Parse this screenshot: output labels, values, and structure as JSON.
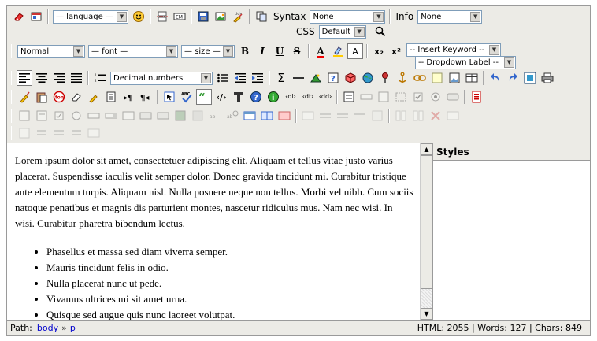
{
  "toolbar": {
    "language_select": "— language —",
    "syntax_label": "Syntax",
    "syntax_value": "None",
    "info_label": "Info",
    "info_value": "None",
    "css_label": "CSS",
    "css_value": "Default",
    "format_select": "Normal",
    "font_select": "— font —",
    "size_select": "— size —",
    "bold": "B",
    "italic": "I",
    "underline": "U",
    "strike": "S",
    "font_color_letter": "A",
    "highlight_letter": "A",
    "subscript": "x₂",
    "superscript": "x²",
    "insert_keyword": "-- Insert Keyword --",
    "dropdown_label": "-- Dropdown Label --",
    "list_style_select": "Decimal numbers",
    "sigma": "Σ",
    "dl_tags": [
      "‹dl›",
      "‹dt›",
      "‹dd›"
    ]
  },
  "content": {
    "paragraph": "Lorem ipsum dolor sit amet, consectetuer adipiscing elit. Aliquam et tellus vitae justo varius placerat. Suspendisse iaculis velit semper dolor. Donec gravida tincidunt mi. Curabitur tristique ante elementum turpis. Aliquam nisl. Nulla posuere neque non tellus. Morbi vel nibh. Cum sociis natoque penatibus et magnis dis parturient montes, nascetur ridiculus mus. Nam nec wisi. In wisi. Curabitur pharetra bibendum lectus.",
    "list_items": [
      "Phasellus et massa sed diam viverra semper.",
      "Mauris tincidunt felis in odio.",
      "Nulla placerat nunc ut pede.",
      "Vivamus ultrices mi sit amet urna.",
      "Quisque sed augue quis nunc laoreet volutpat."
    ]
  },
  "styles_panel": {
    "title": "Styles"
  },
  "statusbar": {
    "path_label": "Path:",
    "path_items": [
      "body",
      "p"
    ],
    "separator": "»",
    "stats": "HTML: 2055 | Words: 127 | Chars: 849"
  },
  "colors": {
    "toolbar_bg": "#ecebe6",
    "border": "#9a9a9a",
    "link": "#0000cc",
    "select_border": "#7f9db9"
  }
}
